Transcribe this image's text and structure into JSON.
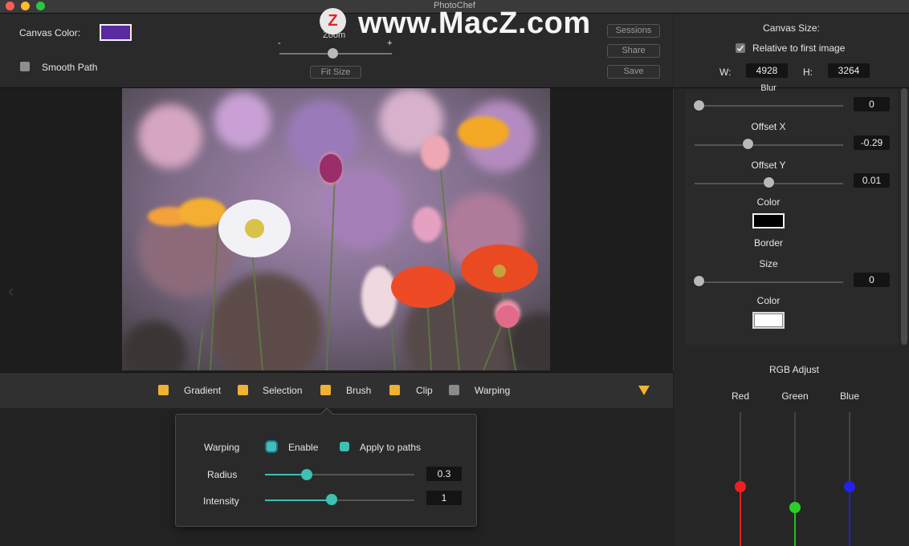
{
  "window": {
    "title": "PhotoChef"
  },
  "watermark": {
    "logo_letter": "Z",
    "text": "www.MacZ.com"
  },
  "toolbar": {
    "canvas_color_label": "Canvas Color:",
    "canvas_color": "#5a2aa0",
    "smooth_path_label": "Smooth Path",
    "zoom_label": "Zoom",
    "zoom_minus": "-",
    "zoom_plus": "+",
    "fit_size_label": "Fit Size",
    "sessions_label": "Sessions",
    "share_label": "Share",
    "save_label": "Save"
  },
  "canvas_size": {
    "title": "Canvas Size:",
    "relative_label": "Relative to first image",
    "relative_checked": true,
    "w_label": "W:",
    "w_value": "4928",
    "h_label": "H:",
    "h_value": "3264"
  },
  "shadow": {
    "blur_label": "Blur",
    "blur_value": "0",
    "offset_x_label": "Offset X",
    "offset_x_value": "-0.29",
    "offset_y_label": "Offset Y",
    "offset_y_value": "0.01",
    "color_label": "Color",
    "color": "#000000"
  },
  "border": {
    "title": "Border",
    "size_label": "Size",
    "size_value": "0",
    "color_label": "Color",
    "color": "#ffffff"
  },
  "rgb": {
    "title": "RGB Adjust",
    "red_label": "Red",
    "green_label": "Green",
    "blue_label": "Blue"
  },
  "tools": {
    "gradient": "Gradient",
    "selection": "Selection",
    "brush": "Brush",
    "clip": "Clip",
    "warping": "Warping",
    "accent": "#f0b232"
  },
  "warping": {
    "title": "Warping",
    "enable_label": "Enable",
    "apply_label": "Apply to paths",
    "radius_label": "Radius",
    "radius_value": "0.3",
    "intensity_label": "Intensity",
    "intensity_value": "1",
    "accent": "#3cc1b3"
  }
}
